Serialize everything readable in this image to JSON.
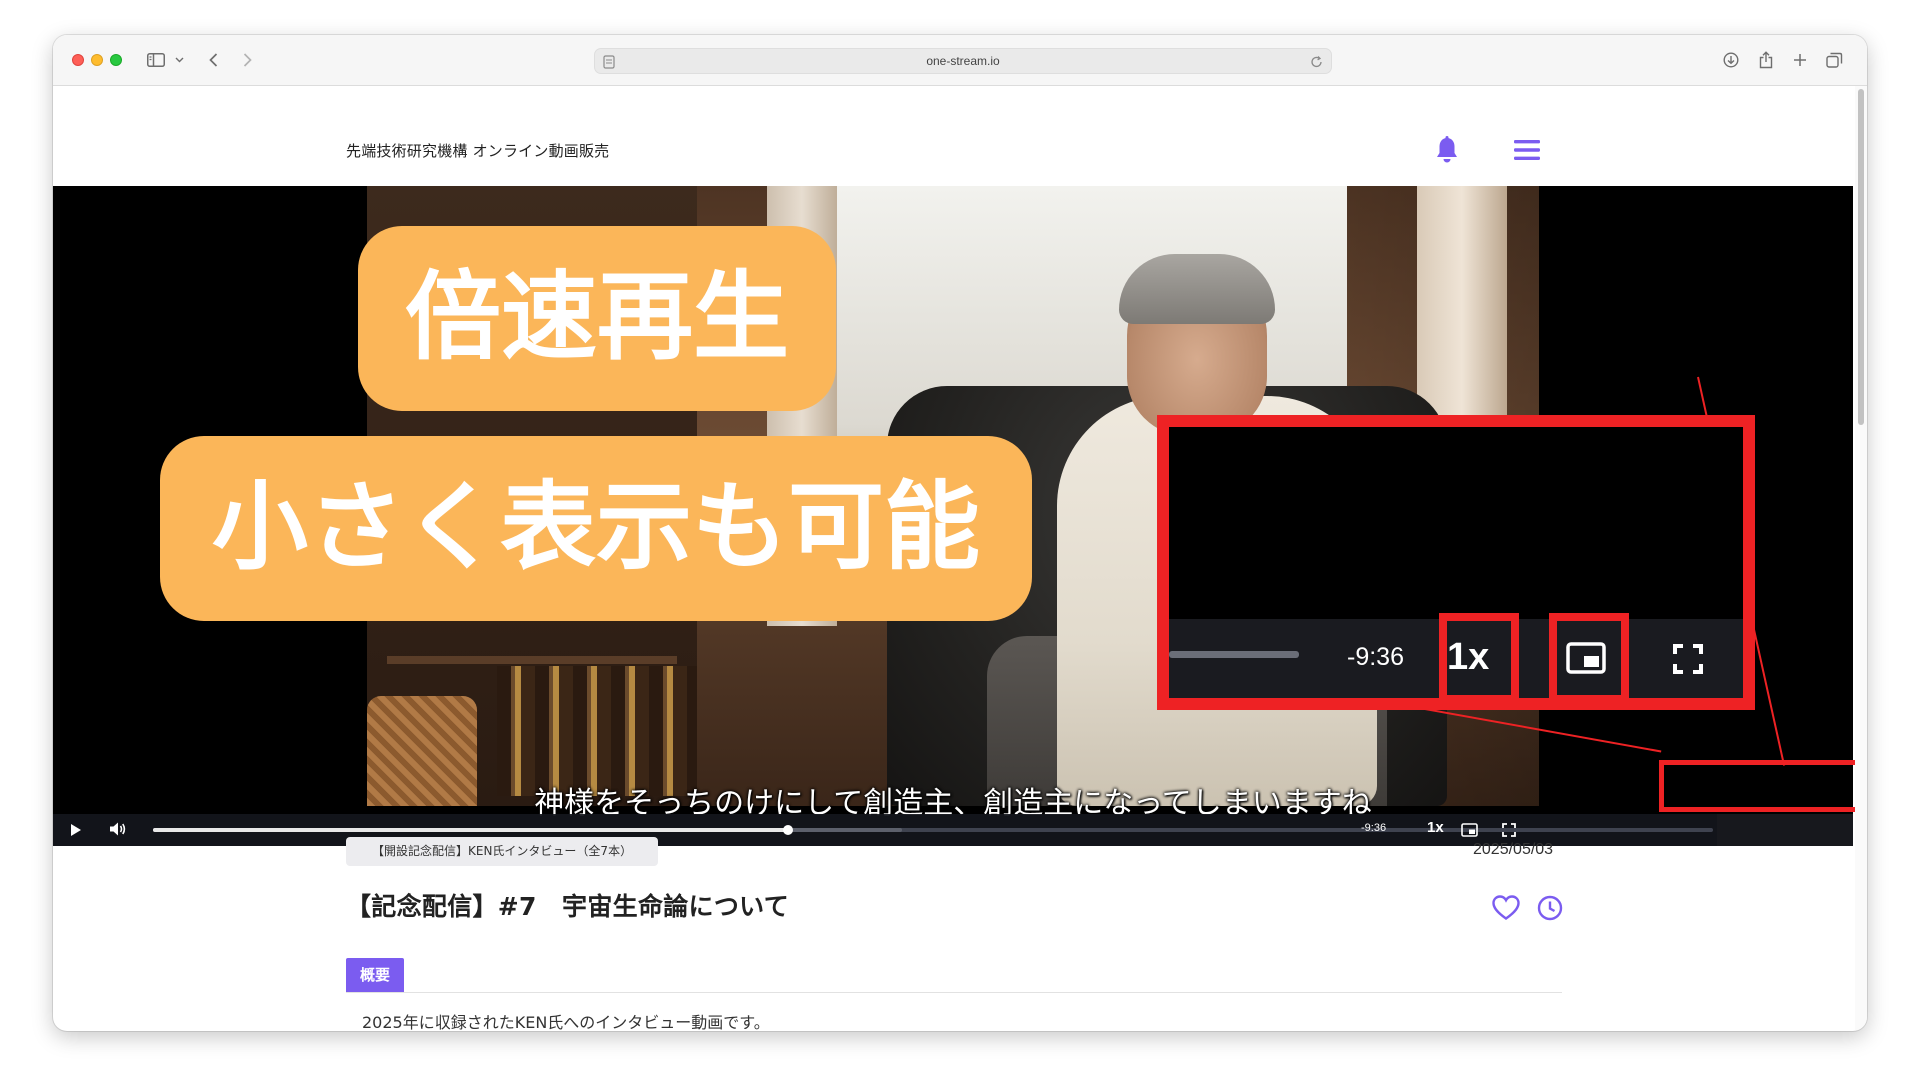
{
  "browser": {
    "url": "one-stream.io",
    "icons": [
      "sidebar-icon",
      "chevron-down-icon",
      "back-icon",
      "forward-icon",
      "page-icon",
      "reload-icon",
      "download-icon",
      "share-icon",
      "new-tab-icon",
      "tabs-overview-icon"
    ]
  },
  "site": {
    "title": "先端技術研究機構 オンライン動画販売",
    "icons": [
      "bell-icon",
      "menu-icon"
    ],
    "accent_color": "#7b5cf0"
  },
  "video": {
    "subtitle": "神様をそっちのけにして創造主、創造主になってしまいますね",
    "progress": 0.407,
    "buffered": 0.48,
    "controls": {
      "time_remaining": "-9:36",
      "playback_rate": "1x",
      "icons": [
        "play-icon",
        "volume-icon",
        "pip-icon",
        "fullscreen-icon"
      ]
    }
  },
  "zoom_inset": {
    "time_remaining": "-9:36",
    "playback_rate": "1x"
  },
  "callouts": {
    "speed": "倍速再生",
    "small_display": "小さく表示も可能",
    "color": "#fbb659"
  },
  "annotation_color": "#ee2224",
  "content": {
    "series_badge": "【開設記念配信】KEN氏インタビュー（全7本）",
    "date": "2025/05/03",
    "title": "【記念配信】#7　宇宙生命論について",
    "tab_overview": "概要",
    "description": "2025年に収録されたKEN氏へのインタビュー動画です。",
    "icons": [
      "heart-icon",
      "clock-icon"
    ]
  }
}
